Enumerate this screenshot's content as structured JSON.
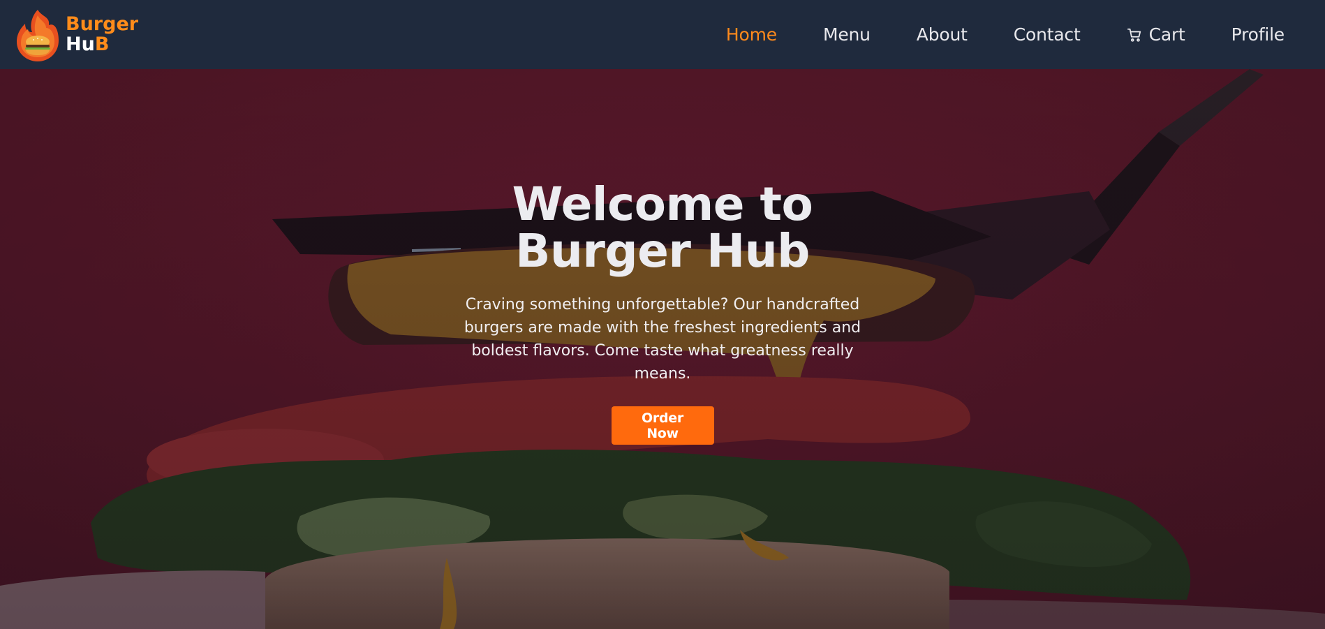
{
  "brand": {
    "line1": "Burger",
    "line2_prefix": "Hu",
    "line2_highlight": "B",
    "logo_icon": "burger-flame-logo"
  },
  "nav": {
    "items": [
      {
        "label": "Home",
        "active": true
      },
      {
        "label": "Menu",
        "active": false
      },
      {
        "label": "About",
        "active": false
      },
      {
        "label": "Contact",
        "active": false
      },
      {
        "label": "Cart",
        "active": false,
        "icon": "cart-icon"
      },
      {
        "label": "Profile",
        "active": false
      }
    ]
  },
  "hero": {
    "title_line1": "Welcome to",
    "title_line2": "Burger Hub",
    "text": "Craving something unforgettable? Our handcrafted burgers are made with the freshest ingredients and boldest flavors. Come taste what greatness really means.",
    "cta_label": "Order Now",
    "background": "burger-photo"
  },
  "colors": {
    "navbar_bg": "#1f2a3d",
    "accent": "#ff8c1a",
    "button": "#ff6a0d",
    "hero_bg": "#5d1a2b"
  }
}
